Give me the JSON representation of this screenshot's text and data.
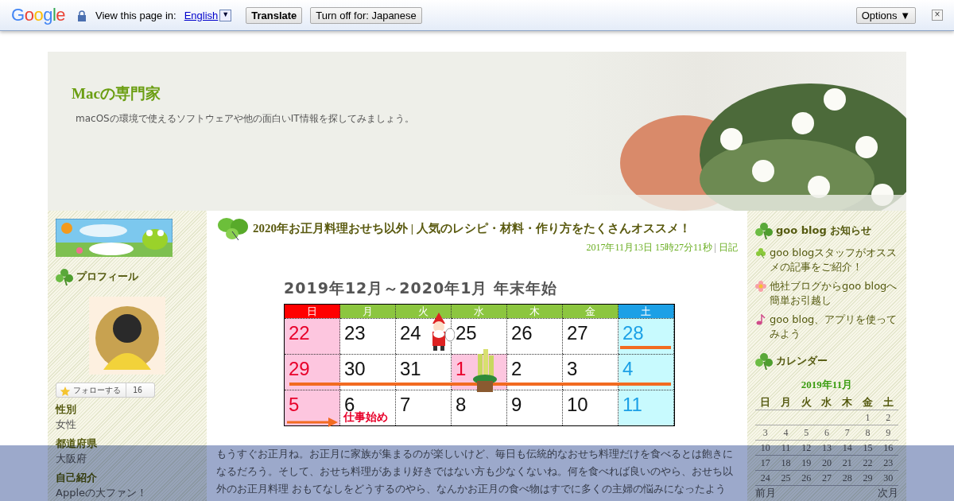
{
  "translate_bar": {
    "logo": "Google",
    "prompt": "View this page in:",
    "language": "English",
    "dropdown": "▼",
    "translate_button": "Translate",
    "turn_off_button": "Turn off for: Japanese",
    "options_button": "Options ▼",
    "close": "×"
  },
  "blog_header": {
    "title": "Macの専門家",
    "description": "macOSの環境で使えるソフトウェアや他の面白いIT情報を探してみましょう。"
  },
  "left_sidebar": {
    "profile_heading": "プロフィール",
    "follow_button": {
      "label": "フォローする",
      "count": "16"
    },
    "fields": [
      {
        "label": "性別",
        "value": "女性"
      },
      {
        "label": "都道府県",
        "value": "大阪府"
      },
      {
        "label": "自己紹介",
        "value": "Appleの大ファン！"
      }
    ]
  },
  "article": {
    "title": "2020年お正月料理おせち以外 | 人気のレシピ・材料・作り方をたくさんオススメ！",
    "date": "2017年11月13日 15時27分11秒",
    "separator": "|",
    "category": "日記",
    "calendar": {
      "title": "2019年12月～2020年1月 年末年始",
      "weekdays": [
        {
          "label": "日",
          "kind": "sunday"
        },
        {
          "label": "月",
          "kind": "weekday"
        },
        {
          "label": "火",
          "kind": "weekday"
        },
        {
          "label": "水",
          "kind": "weekday"
        },
        {
          "label": "木",
          "kind": "weekday"
        },
        {
          "label": "金",
          "kind": "weekday"
        },
        {
          "label": "土",
          "kind": "saturday"
        }
      ],
      "weeks": [
        [
          {
            "day": "22",
            "kind": "sunday"
          },
          {
            "day": "23",
            "kind": "weekday"
          },
          {
            "day": "24",
            "kind": "weekday"
          },
          {
            "day": "25",
            "kind": "weekday"
          },
          {
            "day": "26",
            "kind": "weekday"
          },
          {
            "day": "27",
            "kind": "weekday"
          },
          {
            "day": "28",
            "kind": "saturday"
          }
        ],
        [
          {
            "day": "29",
            "kind": "sunday"
          },
          {
            "day": "30",
            "kind": "weekday"
          },
          {
            "day": "31",
            "kind": "weekday"
          },
          {
            "day": "1",
            "kind": "holiday"
          },
          {
            "day": "2",
            "kind": "weekday"
          },
          {
            "day": "3",
            "kind": "weekday"
          },
          {
            "day": "4",
            "kind": "saturday"
          }
        ],
        [
          {
            "day": "5",
            "kind": "sunday"
          },
          {
            "day": "6",
            "kind": "weekday",
            "note": "仕事始め"
          },
          {
            "day": "7",
            "kind": "weekday"
          },
          {
            "day": "8",
            "kind": "weekday"
          },
          {
            "day": "9",
            "kind": "weekday"
          },
          {
            "day": "10",
            "kind": "weekday"
          },
          {
            "day": "11",
            "kind": "saturday"
          }
        ]
      ]
    },
    "body": "もうすぐお正月ね。お正月に家族が集まるのが楽しいけど、毎日も伝統的なおせち料理だけを食べるとは飽きになるだろう。そして、おせち料理があまり好きではない方も少なくないね。何を食べれば良いのやら、おせち以外のお正月料理 おもてなしをどうするのやら、なんかお正月の食べ物はすでに多くの主婦の悩みになったよう"
  },
  "right_sidebar": {
    "notice_heading": "goo blog お知らせ",
    "notices": [
      {
        "text": "goo blogスタッフがオススメの記事をご紹介！",
        "kind": "clover"
      },
      {
        "text": "他社ブログからgoo blogへ簡単お引越し",
        "kind": "flower"
      },
      {
        "text": "goo blog、アプリを使ってみよう",
        "kind": "note"
      }
    ],
    "calendar_heading": "カレンダー",
    "calendar": {
      "month": "2019年11月",
      "weekdays": [
        "日",
        "月",
        "火",
        "水",
        "木",
        "金",
        "土"
      ],
      "weeks": [
        [
          "1",
          "2"
        ],
        [
          "3",
          "4",
          "5",
          "6",
          "7",
          "8",
          "9"
        ],
        [
          "10",
          "11",
          "12",
          "13",
          "14",
          "15",
          "16"
        ],
        [
          "17",
          "18",
          "19",
          "20",
          "21",
          "22",
          "23"
        ],
        [
          "24",
          "25",
          "26",
          "27",
          "28",
          "29",
          "30"
        ]
      ],
      "prev": "前月",
      "next": "次月"
    }
  }
}
